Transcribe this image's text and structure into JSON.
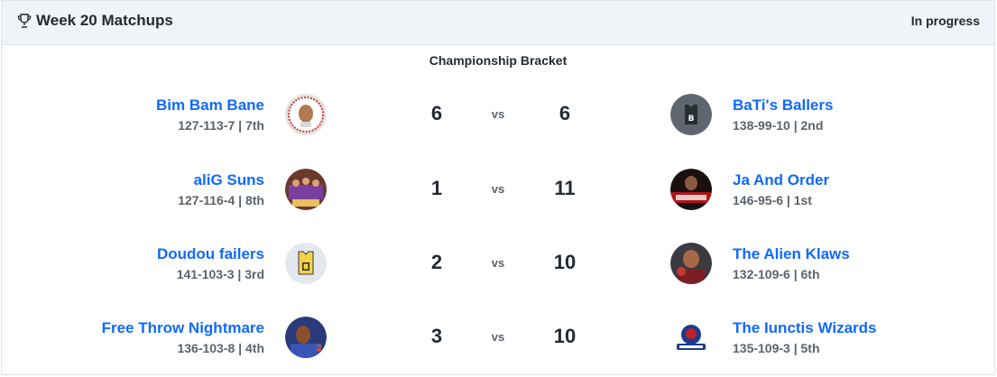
{
  "header": {
    "title": "Week 20 Matchups",
    "status": "In progress",
    "trophy_icon": "trophy-icon"
  },
  "bracket_label": "Championship Bracket",
  "vs_label": "vs",
  "matchups": [
    {
      "left": {
        "name": "Bim Bam Bane",
        "record": "127-113-7 | 7th",
        "score": "6"
      },
      "right": {
        "name": "BaTi's Ballers",
        "record": "138-99-10 | 2nd",
        "score": "6"
      }
    },
    {
      "left": {
        "name": "aliG Suns",
        "record": "127-116-4 | 8th",
        "score": "1"
      },
      "right": {
        "name": "Ja And Order",
        "record": "146-95-6 | 1st",
        "score": "11"
      }
    },
    {
      "left": {
        "name": "Doudou failers",
        "record": "141-103-3 | 3rd",
        "score": "2"
      },
      "right": {
        "name": "The Alien Klaws",
        "record": "132-109-6 | 6th",
        "score": "10"
      }
    },
    {
      "left": {
        "name": "Free Throw Nightmare",
        "record": "136-103-8 | 4th",
        "score": "3"
      },
      "right": {
        "name": "The Iunctis Wizards",
        "record": "135-109-3 | 5th",
        "score": "10"
      }
    }
  ],
  "colors": {
    "link": "#0f69ff",
    "header_bg": "#f0f3f8",
    "text": "#232a31",
    "muted": "#5b636a"
  }
}
